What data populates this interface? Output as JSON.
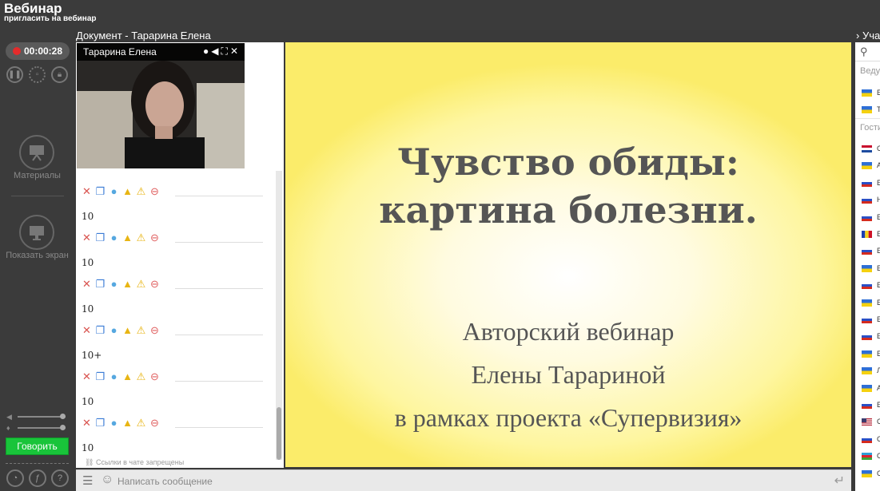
{
  "header": {
    "title": "Вебинар",
    "invite": "пригласить на вебинар"
  },
  "document_title": "Документ - Тарарина Елена",
  "right_title": "Участники",
  "left": {
    "timer": "00:00:28",
    "materials_label": "Материалы",
    "share_label": "Показать экран",
    "talk_label": "Говорить"
  },
  "video": {
    "name": "Тарарина Елена"
  },
  "chat": {
    "messages": [
      "10",
      "10",
      "10",
      "10+",
      "10",
      "10"
    ],
    "links_note": "Ссылки в чате запрещены",
    "input_placeholder": "Написать сообщение"
  },
  "slide": {
    "title_line1": "Чувство обиды:",
    "title_line2": "картина болезни.",
    "sub_line1": "Авторский вебинар",
    "sub_line2": "Елены Тарариной",
    "sub_line3": "в рамках проекта «Супервизия»"
  },
  "participants": {
    "search_icon": "search-icon",
    "hosts_label": "Ведущие",
    "guests_label": "Гости",
    "hosts": [
      {
        "flag": "ua",
        "initial": "Е"
      },
      {
        "flag": "ua",
        "initial": "Т"
      }
    ],
    "guests": [
      {
        "flag": "nl",
        "initial": "С"
      },
      {
        "flag": "ua",
        "initial": "А"
      },
      {
        "flag": "ru",
        "initial": "Е"
      },
      {
        "flag": "ru",
        "initial": "Н"
      },
      {
        "flag": "ru",
        "initial": "Е"
      },
      {
        "flag": "ro",
        "initial": "Е"
      },
      {
        "flag": "ru",
        "initial": "Е"
      },
      {
        "flag": "ua",
        "initial": "Е"
      },
      {
        "flag": "ru",
        "initial": "Е"
      },
      {
        "flag": "ua",
        "initial": "Е"
      },
      {
        "flag": "ru",
        "initial": "Е"
      },
      {
        "flag": "ru",
        "initial": "Е"
      },
      {
        "flag": "ua",
        "initial": "Е"
      },
      {
        "flag": "ua",
        "initial": "Л"
      },
      {
        "flag": "ua",
        "initial": "А"
      },
      {
        "flag": "ru",
        "initial": "Е"
      },
      {
        "flag": "us",
        "initial": "С"
      },
      {
        "flag": "ru",
        "initial": "С"
      },
      {
        "flag": "az",
        "initial": "С"
      },
      {
        "flag": "ua",
        "initial": "С"
      }
    ]
  },
  "colors": {
    "talk_button": "#19c43a",
    "record_dot": "#e42b2b",
    "slide_bg": "#fef6a0"
  }
}
